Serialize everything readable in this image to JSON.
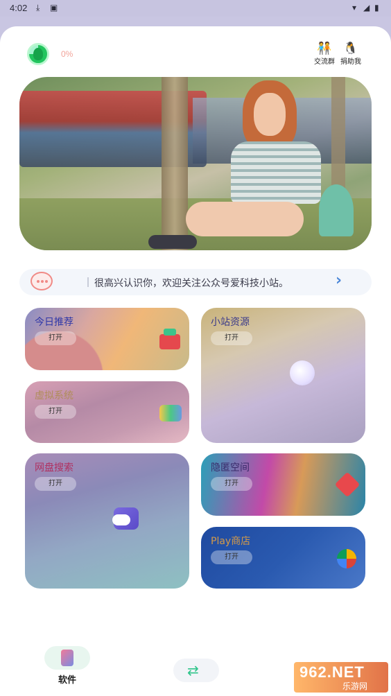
{
  "status_bar": {
    "time": "4:02",
    "icons": [
      "download-icon",
      "a-icon",
      "wifi-icon",
      "signal-icon",
      "battery-icon"
    ]
  },
  "header": {
    "progress_percent": "0%",
    "progress_fraction": 0.0,
    "actions": [
      {
        "label": "交流群",
        "icon": "group-chat-icon"
      },
      {
        "label": "捐助我",
        "icon": "donate-icon"
      }
    ]
  },
  "notice": {
    "text": "很高兴认识你，欢迎关注公众号爱科技小站。"
  },
  "cards": [
    {
      "title": "今日推荐",
      "button": "打开",
      "icon": "wallet-icon"
    },
    {
      "title": "虚拟系统",
      "button": "打开",
      "icon": "chart-icon"
    },
    {
      "title": "小站资源",
      "button": "打开",
      "icon": "bubble-icon"
    },
    {
      "title": "网盘搜索",
      "button": "打开",
      "icon": "cloud-upload-icon"
    },
    {
      "title": "隐匿空间",
      "button": "打开",
      "icon": "heart-chevron-icon"
    },
    {
      "title": "Play商店",
      "button": "打开",
      "icon": "photos-icon"
    }
  ],
  "bottom_nav": [
    {
      "label": "软件",
      "icon": "apps-icon",
      "active": true
    },
    {
      "label": "",
      "icon": "transfer-icon",
      "active": false
    }
  ],
  "watermark": {
    "main": "962.NET",
    "sub": "乐游网"
  },
  "colors": {
    "accent_blue": "#4a86d8",
    "progress_text": "#f2a49a",
    "notice_icon": "#f08a86"
  }
}
